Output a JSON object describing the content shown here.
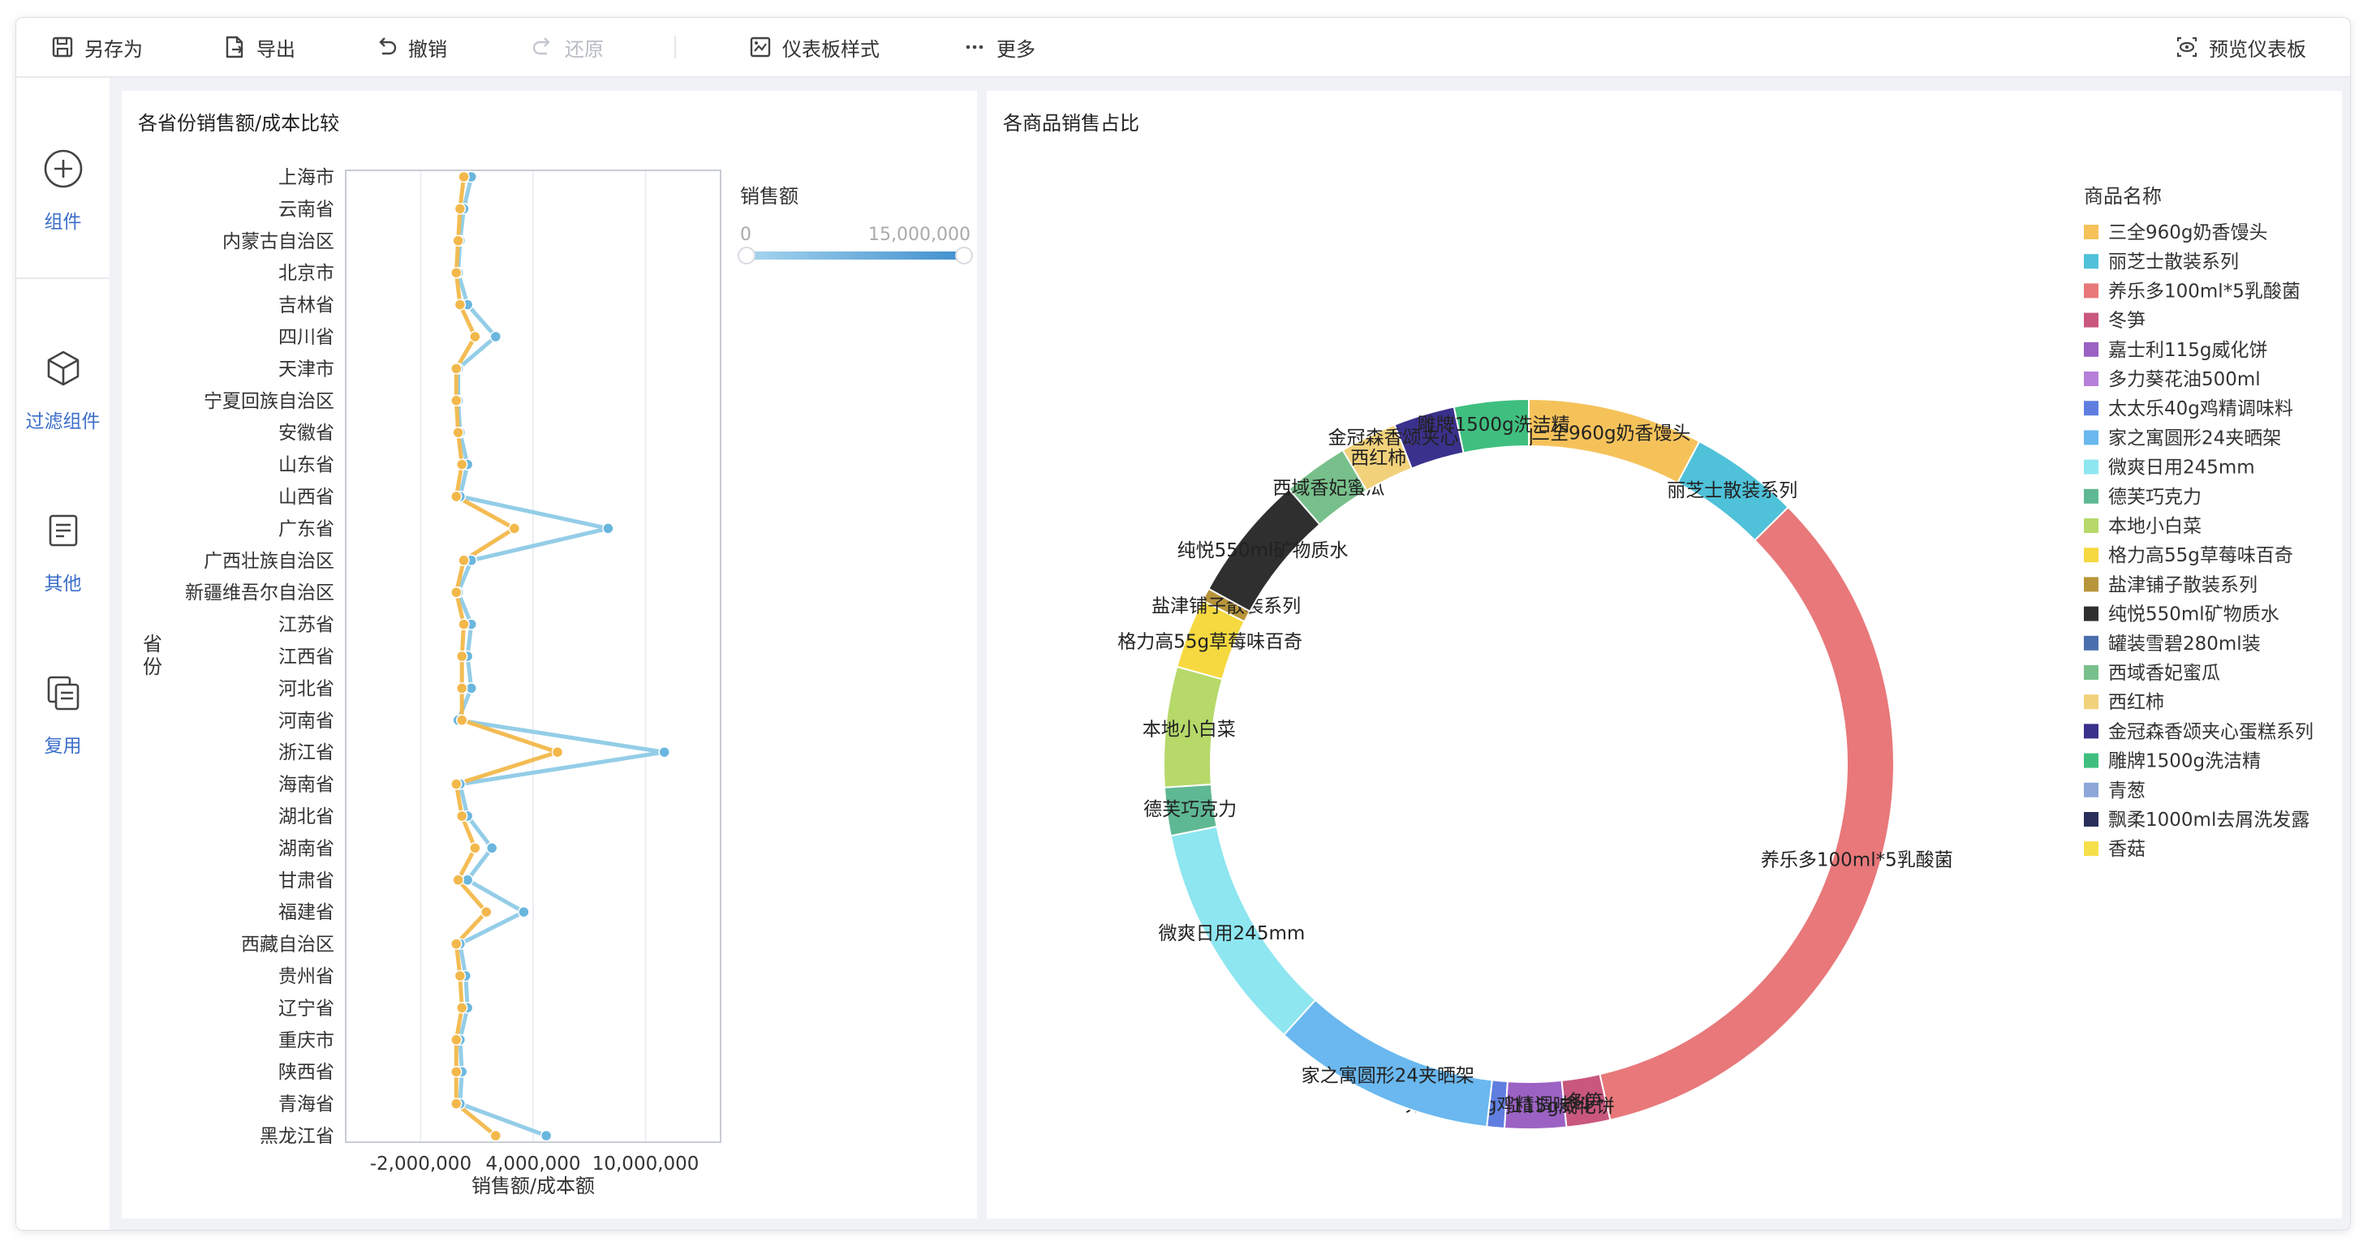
{
  "toolbar": {
    "save_as": "另存为",
    "export": "导出",
    "undo": "撤销",
    "redo": "还原",
    "dashboard_style": "仪表板样式",
    "more": "更多",
    "preview": "预览仪表板"
  },
  "sidebar": {
    "items": [
      {
        "label": "组件",
        "icon": "plus-circle-icon"
      },
      {
        "label": "过滤组件",
        "icon": "cube-icon"
      },
      {
        "label": "其他",
        "icon": "document-icon"
      },
      {
        "label": "复用",
        "icon": "copy-icon"
      }
    ]
  },
  "colors": {
    "accent": "#3b6ec9",
    "sales_line": "#8ecae6",
    "cost_line": "#f2b84b"
  },
  "chart_data": [
    {
      "type": "line",
      "title": "各省份销售额/成本比较",
      "orientation": "horizontal",
      "ylabel": "省份",
      "xlabel": "销售额/成本额",
      "categories": [
        "上海市",
        "云南省",
        "内蒙古自治区",
        "北京市",
        "吉林省",
        "四川省",
        "天津市",
        "宁夏回族自治区",
        "安徽省",
        "山东省",
        "山西省",
        "广东省",
        "广西壮族自治区",
        "新疆维吾尔自治区",
        "江苏省",
        "江西省",
        "河北省",
        "河南省",
        "浙江省",
        "海南省",
        "湖北省",
        "湖南省",
        "甘肃省",
        "福建省",
        "西藏自治区",
        "贵州省",
        "辽宁省",
        "重庆市",
        "陕西省",
        "青海省",
        "黑龙江省"
      ],
      "x_ticks": [
        "-2,000,000",
        "4,000,000",
        "10,000,000"
      ],
      "xlim": [
        -6000000,
        14000000
      ],
      "series": [
        {
          "name": "销售额",
          "values": [
            700000,
            300000,
            100000,
            0,
            500000,
            2000000,
            0,
            0,
            100000,
            500000,
            100000,
            8000000,
            700000,
            0,
            700000,
            500000,
            700000,
            0,
            11000000,
            100000,
            500000,
            1800000,
            500000,
            3500000,
            100000,
            400000,
            500000,
            100000,
            200000,
            100000,
            4700000
          ]
        },
        {
          "name": "成本额",
          "values": [
            300000,
            100000,
            0,
            -100000,
            100000,
            900000,
            -100000,
            -100000,
            0,
            200000,
            -100000,
            3000000,
            300000,
            -100000,
            300000,
            200000,
            200000,
            200000,
            5300000,
            -100000,
            200000,
            900000,
            0,
            1500000,
            -100000,
            100000,
            200000,
            -100000,
            -100000,
            -100000,
            2000000
          ]
        }
      ],
      "legend": {
        "title": "销售额",
        "min_label": "0",
        "max_label": "15,000,000",
        "placement": "top-right"
      }
    },
    {
      "type": "pie",
      "variant": "donut",
      "title": "各商品销售占比",
      "legend": {
        "title": "商品名称",
        "placement": "right"
      },
      "slices": [
        {
          "label": "三全960g奶香馒头",
          "value": 8.0,
          "color": "#f5c25a"
        },
        {
          "label": "丽芝士散装系列",
          "value": 5.0,
          "color": "#4fc1d9"
        },
        {
          "label": "养乐多100ml*5乳酸菌",
          "value": 35.0,
          "color": "#e8787a"
        },
        {
          "label": "冬笋",
          "value": 2.0,
          "color": "#c9577e"
        },
        {
          "label": "嘉士利115g威化饼",
          "value": 2.8,
          "color": "#9b62c4"
        },
        {
          "label": "多力葵花油500ml",
          "value": 0.0,
          "color": "#b67fd9"
        },
        {
          "label": "太太乐40g鸡精调味料",
          "value": 0.8,
          "color": "#5f7ee0"
        },
        {
          "label": "家之寓圆形24夹晒架",
          "value": 10.2,
          "color": "#6ab8ef"
        },
        {
          "label": "微爽日用245mm",
          "value": 10.5,
          "color": "#8ee6f0"
        },
        {
          "label": "德芙巧克力",
          "value": 2.2,
          "color": "#5fb894"
        },
        {
          "label": "本地小白菜",
          "value": 5.5,
          "color": "#b6d96a"
        },
        {
          "label": "格力高55g草莓味百奇",
          "value": 3.2,
          "color": "#f6d940"
        },
        {
          "label": "盐津铺子散装系列",
          "value": 0.6,
          "color": "#b8953a"
        },
        {
          "label": "纯悦550ml矿物质水",
          "value": 5.8,
          "color": "#2f2f2f"
        },
        {
          "label": "罐装雪碧280ml装",
          "value": 0.0,
          "color": "#4a6fad"
        },
        {
          "label": "西域香妃蜜瓜",
          "value": 3.0,
          "color": "#78c08b"
        },
        {
          "label": "西红柿",
          "value": 2.6,
          "color": "#f1d17a"
        },
        {
          "label": "金冠森香颂夹心蛋糕系列",
          "value": 2.8,
          "color": "#3a318c"
        },
        {
          "label": "雕牌1500g洗洁精",
          "value": 3.4,
          "color": "#3fbf7f"
        },
        {
          "label": "青葱",
          "value": 0.0,
          "color": "#8ea7d9"
        },
        {
          "label": "飘柔1000ml去屑洗发露",
          "value": 0.0,
          "color": "#2a2f5a"
        },
        {
          "label": "香菇",
          "value": 0.0,
          "color": "#f5e04a"
        }
      ]
    }
  ]
}
